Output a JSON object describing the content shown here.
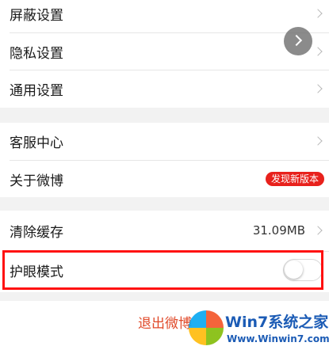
{
  "settings_group_1": [
    {
      "label": "屏蔽设置"
    },
    {
      "label": "隐私设置"
    },
    {
      "label": "通用设置"
    }
  ],
  "settings_group_2": [
    {
      "label": "客服中心"
    },
    {
      "label": "关于微博",
      "badge": "发现新版本"
    }
  ],
  "settings_group_3": [
    {
      "label": "清除缓存",
      "value": "31.09MB"
    },
    {
      "label": "护眼模式",
      "toggle_on": false
    }
  ],
  "logout_label": "退出微博",
  "watermark": {
    "title": "Win7系统之家",
    "site": "Www.Winwin7.com"
  },
  "colors": {
    "badge": "#e8211c",
    "highlight": "#ff1010",
    "logout": "#e04a2a"
  }
}
